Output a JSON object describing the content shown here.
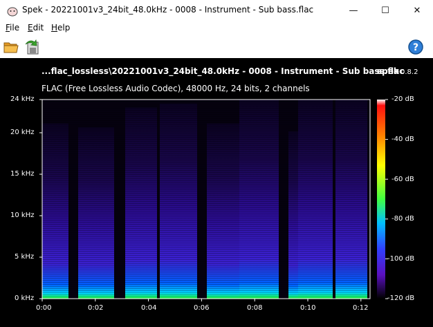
{
  "window": {
    "title": "Spek - 20221001v3_24bit_48.0kHz - 0008 - Instrument - Sub bass.flac",
    "minimize_glyph": "—",
    "maximize_glyph": "☐",
    "close_glyph": "✕"
  },
  "menu": {
    "file": {
      "accel": "F",
      "rest": "ile"
    },
    "edit": {
      "accel": "E",
      "rest": "dit"
    },
    "help": {
      "accel": "H",
      "rest": "elp"
    }
  },
  "toolbar": {
    "open_icon": "folder-open-icon",
    "save_icon": "save-export-icon",
    "help_icon": "help-question-icon",
    "help_glyph": "?"
  },
  "spectrogram": {
    "title": "...flac_lossless\\20221001v3_24bit_48.0kHz - 0008 - Instrument - Sub bass.flac",
    "brand": "spek",
    "version": "0.8.2",
    "subtitle": "FLAC (Free Lossless Audio Codec), 48000 Hz, 24 bits, 2 channels",
    "y_ticks": [
      "24 kHz",
      "20 kHz",
      "15 kHz",
      "10 kHz",
      "5 kHz",
      "0 kHz"
    ],
    "x_ticks": [
      "0:00",
      "0:02",
      "0:04",
      "0:06",
      "0:08",
      "0:10",
      "0:12"
    ],
    "db_ticks": [
      "-20 dB",
      "-40 dB",
      "-60 dB",
      "-80 dB",
      "-100 dB",
      "-120 dB"
    ],
    "colors": {
      "background": "#000000",
      "low": "#000010",
      "mid": "#3a10b0",
      "high": "#00d0ff"
    }
  }
}
